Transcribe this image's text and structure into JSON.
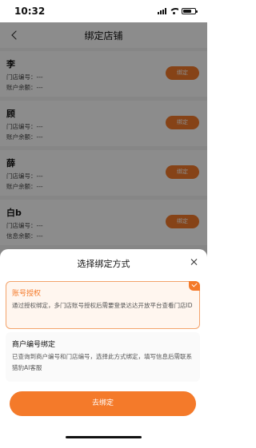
{
  "status_bar": {
    "time": "10:32"
  },
  "nav": {
    "title": "绑定店铺"
  },
  "stores": [
    {
      "name": "李",
      "store_no_label": "门店编号：---",
      "balance_label": "账户余额：---",
      "button": "绑定"
    },
    {
      "name": "顾",
      "store_no_label": "门店编号：---",
      "balance_label": "账户余额：---",
      "button": "绑定"
    },
    {
      "name": "薛",
      "store_no_label": "门店编号：---",
      "balance_label": "账户余额：---",
      "button": "绑定"
    },
    {
      "name": "白b",
      "store_no_label": "门店编号：---",
      "balance_label": "信息余额：---",
      "button": "绑定"
    }
  ],
  "sheet": {
    "title": "选择绑定方式",
    "options": [
      {
        "title": "账号授权",
        "desc": "通过授权绑定，多门店账号授权后需要登录达达开放平台查看门店ID",
        "selected": true
      },
      {
        "title": "商户编号绑定",
        "desc": "已查询到商户编号和门店编号，选择此方式绑定，填写信息后需联系猎豹AI客服",
        "selected": false
      }
    ],
    "submit_label": "去绑定"
  },
  "colors": {
    "accent": "#f47a2a",
    "selected_bg": "#fff6ef",
    "selected_border": "#f3a36b"
  }
}
